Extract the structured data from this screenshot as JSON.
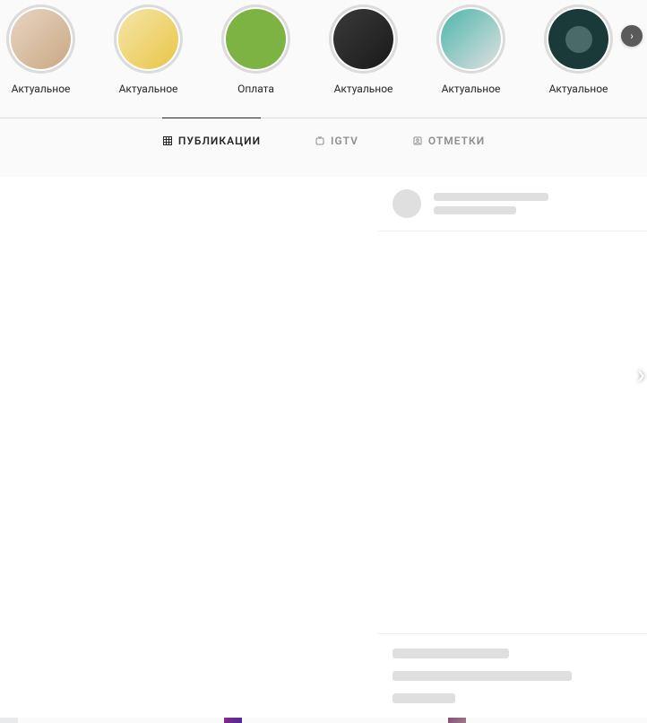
{
  "highlights": {
    "items": [
      {
        "label": "Актуальное"
      },
      {
        "label": "Актуальное"
      },
      {
        "label": "Оплата"
      },
      {
        "label": "Актуальное"
      },
      {
        "label": "Актуальное"
      },
      {
        "label": "Актуальное"
      }
    ],
    "nav_next": "›"
  },
  "tabs": {
    "posts": {
      "label": "ПУБЛИКАЦИИ",
      "active": true
    },
    "igtv": {
      "label": "IGTV",
      "active": false
    },
    "tagged": {
      "label": "ОТМЕТКИ",
      "active": false
    }
  },
  "modal": {
    "nav_next": "›"
  }
}
